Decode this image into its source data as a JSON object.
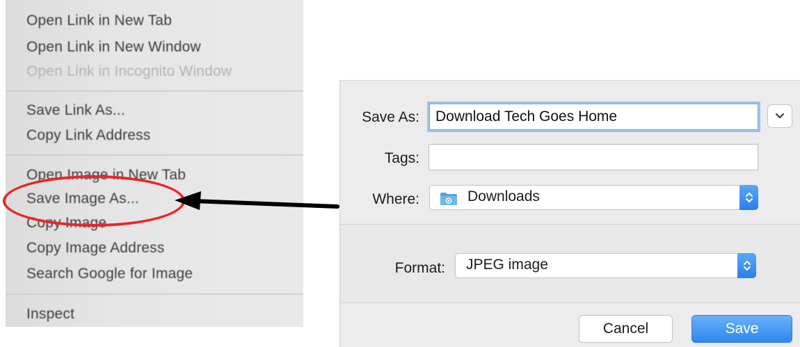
{
  "context_menu": {
    "items": [
      {
        "label": "Open Link in New Tab",
        "disabled": false
      },
      {
        "label": "Open Link in New Window",
        "disabled": false
      },
      {
        "label": "Open Link in Incognito Window",
        "disabled": true
      },
      {
        "label": "Save Link As...",
        "disabled": false
      },
      {
        "label": "Copy Link Address",
        "disabled": false
      },
      {
        "label": "Open Image in New Tab",
        "disabled": false
      },
      {
        "label": "Save Image As...",
        "disabled": false,
        "highlighted": true
      },
      {
        "label": "Copy Image",
        "disabled": false
      },
      {
        "label": "Copy Image Address",
        "disabled": false
      },
      {
        "label": "Search Google for Image",
        "disabled": false
      },
      {
        "label": "Inspect",
        "disabled": false
      }
    ],
    "highlight_color": "#e8262a"
  },
  "save_dialog": {
    "save_as_label": "Save As:",
    "save_as_value": "Download Tech Goes Home",
    "tags_label": "Tags:",
    "tags_value": "",
    "where_label": "Where:",
    "where_value": "Downloads",
    "where_icon": "folder-icon",
    "format_label": "Format:",
    "format_value": "JPEG image",
    "cancel_label": "Cancel",
    "save_label": "Save",
    "accent_color": "#2f86ee"
  }
}
